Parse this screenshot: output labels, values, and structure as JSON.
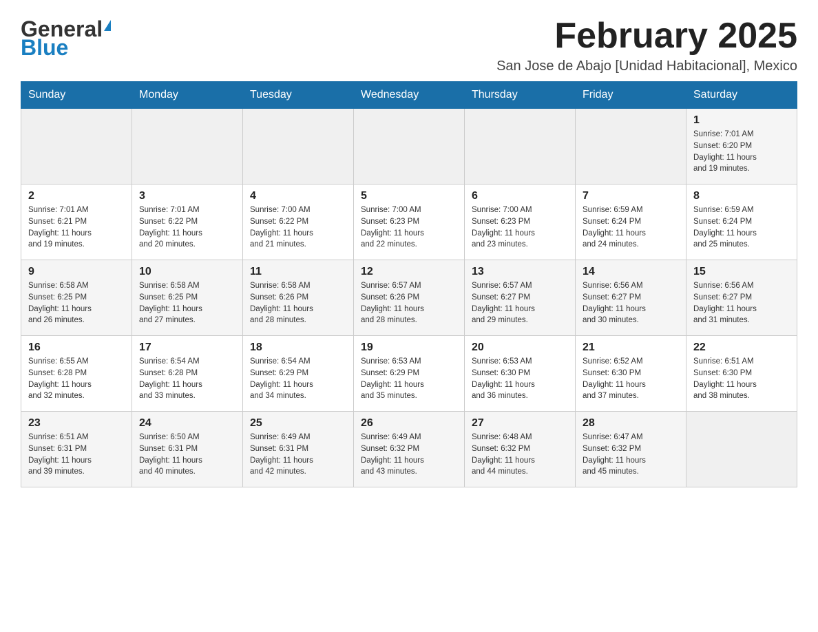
{
  "header": {
    "logo_general": "General",
    "logo_blue": "Blue",
    "month_title": "February 2025",
    "location": "San Jose de Abajo [Unidad Habitacional], Mexico"
  },
  "weekdays": [
    "Sunday",
    "Monday",
    "Tuesday",
    "Wednesday",
    "Thursday",
    "Friday",
    "Saturday"
  ],
  "weeks": [
    {
      "row_class": "row-odd",
      "days": [
        {
          "num": "",
          "info": ""
        },
        {
          "num": "",
          "info": ""
        },
        {
          "num": "",
          "info": ""
        },
        {
          "num": "",
          "info": ""
        },
        {
          "num": "",
          "info": ""
        },
        {
          "num": "",
          "info": ""
        },
        {
          "num": "1",
          "info": "Sunrise: 7:01 AM\nSunset: 6:20 PM\nDaylight: 11 hours\nand 19 minutes."
        }
      ]
    },
    {
      "row_class": "row-even",
      "days": [
        {
          "num": "2",
          "info": "Sunrise: 7:01 AM\nSunset: 6:21 PM\nDaylight: 11 hours\nand 19 minutes."
        },
        {
          "num": "3",
          "info": "Sunrise: 7:01 AM\nSunset: 6:22 PM\nDaylight: 11 hours\nand 20 minutes."
        },
        {
          "num": "4",
          "info": "Sunrise: 7:00 AM\nSunset: 6:22 PM\nDaylight: 11 hours\nand 21 minutes."
        },
        {
          "num": "5",
          "info": "Sunrise: 7:00 AM\nSunset: 6:23 PM\nDaylight: 11 hours\nand 22 minutes."
        },
        {
          "num": "6",
          "info": "Sunrise: 7:00 AM\nSunset: 6:23 PM\nDaylight: 11 hours\nand 23 minutes."
        },
        {
          "num": "7",
          "info": "Sunrise: 6:59 AM\nSunset: 6:24 PM\nDaylight: 11 hours\nand 24 minutes."
        },
        {
          "num": "8",
          "info": "Sunrise: 6:59 AM\nSunset: 6:24 PM\nDaylight: 11 hours\nand 25 minutes."
        }
      ]
    },
    {
      "row_class": "row-odd",
      "days": [
        {
          "num": "9",
          "info": "Sunrise: 6:58 AM\nSunset: 6:25 PM\nDaylight: 11 hours\nand 26 minutes."
        },
        {
          "num": "10",
          "info": "Sunrise: 6:58 AM\nSunset: 6:25 PM\nDaylight: 11 hours\nand 27 minutes."
        },
        {
          "num": "11",
          "info": "Sunrise: 6:58 AM\nSunset: 6:26 PM\nDaylight: 11 hours\nand 28 minutes."
        },
        {
          "num": "12",
          "info": "Sunrise: 6:57 AM\nSunset: 6:26 PM\nDaylight: 11 hours\nand 28 minutes."
        },
        {
          "num": "13",
          "info": "Sunrise: 6:57 AM\nSunset: 6:27 PM\nDaylight: 11 hours\nand 29 minutes."
        },
        {
          "num": "14",
          "info": "Sunrise: 6:56 AM\nSunset: 6:27 PM\nDaylight: 11 hours\nand 30 minutes."
        },
        {
          "num": "15",
          "info": "Sunrise: 6:56 AM\nSunset: 6:27 PM\nDaylight: 11 hours\nand 31 minutes."
        }
      ]
    },
    {
      "row_class": "row-even",
      "days": [
        {
          "num": "16",
          "info": "Sunrise: 6:55 AM\nSunset: 6:28 PM\nDaylight: 11 hours\nand 32 minutes."
        },
        {
          "num": "17",
          "info": "Sunrise: 6:54 AM\nSunset: 6:28 PM\nDaylight: 11 hours\nand 33 minutes."
        },
        {
          "num": "18",
          "info": "Sunrise: 6:54 AM\nSunset: 6:29 PM\nDaylight: 11 hours\nand 34 minutes."
        },
        {
          "num": "19",
          "info": "Sunrise: 6:53 AM\nSunset: 6:29 PM\nDaylight: 11 hours\nand 35 minutes."
        },
        {
          "num": "20",
          "info": "Sunrise: 6:53 AM\nSunset: 6:30 PM\nDaylight: 11 hours\nand 36 minutes."
        },
        {
          "num": "21",
          "info": "Sunrise: 6:52 AM\nSunset: 6:30 PM\nDaylight: 11 hours\nand 37 minutes."
        },
        {
          "num": "22",
          "info": "Sunrise: 6:51 AM\nSunset: 6:30 PM\nDaylight: 11 hours\nand 38 minutes."
        }
      ]
    },
    {
      "row_class": "row-odd",
      "days": [
        {
          "num": "23",
          "info": "Sunrise: 6:51 AM\nSunset: 6:31 PM\nDaylight: 11 hours\nand 39 minutes."
        },
        {
          "num": "24",
          "info": "Sunrise: 6:50 AM\nSunset: 6:31 PM\nDaylight: 11 hours\nand 40 minutes."
        },
        {
          "num": "25",
          "info": "Sunrise: 6:49 AM\nSunset: 6:31 PM\nDaylight: 11 hours\nand 42 minutes."
        },
        {
          "num": "26",
          "info": "Sunrise: 6:49 AM\nSunset: 6:32 PM\nDaylight: 11 hours\nand 43 minutes."
        },
        {
          "num": "27",
          "info": "Sunrise: 6:48 AM\nSunset: 6:32 PM\nDaylight: 11 hours\nand 44 minutes."
        },
        {
          "num": "28",
          "info": "Sunrise: 6:47 AM\nSunset: 6:32 PM\nDaylight: 11 hours\nand 45 minutes."
        },
        {
          "num": "",
          "info": ""
        }
      ]
    }
  ]
}
